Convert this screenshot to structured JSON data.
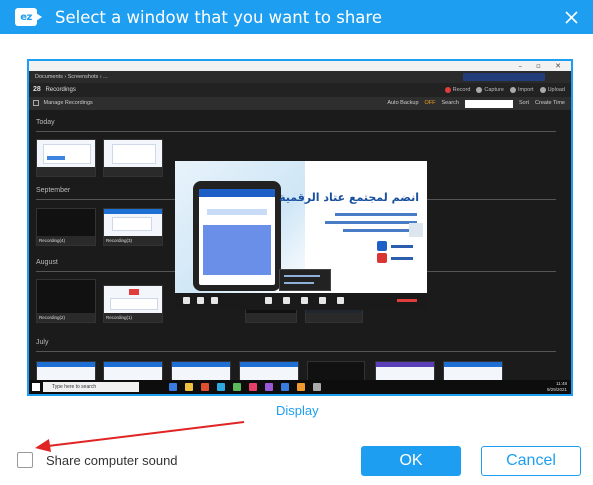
{
  "dialog": {
    "title": "Select a window that you want to share",
    "app_logo_text": "ez",
    "close_icon": "close-icon"
  },
  "preview": {
    "title_path": "Documents › Screenshots › ...",
    "window_controls": "– ▫ ✕",
    "header": {
      "count": "28",
      "count_label": "Recordings",
      "actions": [
        "Record",
        "Capture",
        "Import",
        "Upload"
      ]
    },
    "toolbar": {
      "manage_label": "Manage Recordings",
      "auto_backup_label": "Auto Backup",
      "auto_backup_value": "OFF",
      "search_label": "Search",
      "sort_label": "Sort",
      "sort_value": "Create Time"
    },
    "sections": [
      "Today",
      "September",
      "August",
      "July"
    ],
    "thumb_captions": [
      "Recording(4)",
      "Recording(3)",
      "Recording(2)",
      "Recording(1)"
    ],
    "taskbar": {
      "search_placeholder": "Type here to search",
      "clock_time": "11:48",
      "clock_date": "9/29/2021"
    },
    "overlay": {
      "headline": "انضم لمجتمع عتاد الرقمية"
    }
  },
  "display_label": "Display",
  "share_sound": {
    "label": "Share computer sound",
    "checked": false
  },
  "buttons": {
    "ok": "OK",
    "cancel": "Cancel"
  },
  "colors": {
    "accent": "#1e9ef0",
    "arrow": "#e02424"
  }
}
